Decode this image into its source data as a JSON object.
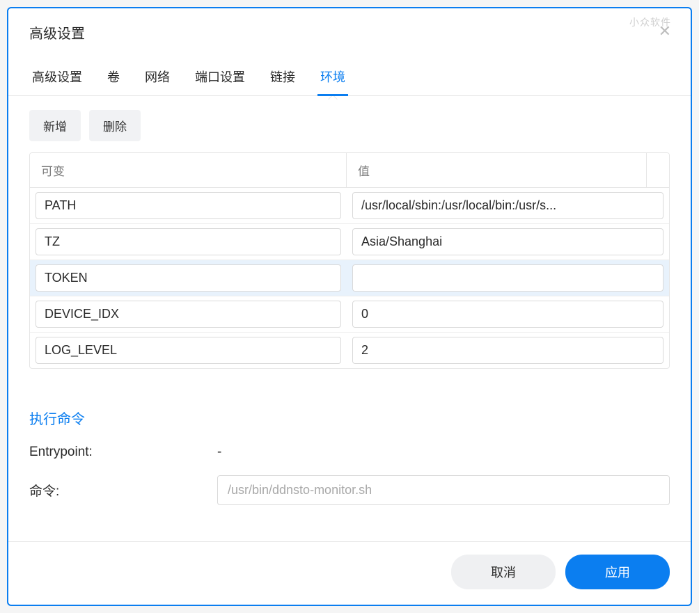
{
  "modal": {
    "title": "高级设置",
    "watermark": "小众软件"
  },
  "tabs": [
    {
      "label": "高级设置",
      "active": false
    },
    {
      "label": "卷",
      "active": false
    },
    {
      "label": "网络",
      "active": false
    },
    {
      "label": "端口设置",
      "active": false
    },
    {
      "label": "链接",
      "active": false
    },
    {
      "label": "环境",
      "active": true
    }
  ],
  "toolbar": {
    "add": "新增",
    "delete": "删除"
  },
  "table": {
    "header_key": "可变",
    "header_value": "值",
    "rows": [
      {
        "key": "PATH",
        "value": "/usr/local/sbin:/usr/local/bin:/usr/s...",
        "selected": false
      },
      {
        "key": "TZ",
        "value": "Asia/Shanghai",
        "selected": false
      },
      {
        "key": "TOKEN",
        "value": "",
        "selected": true
      },
      {
        "key": "DEVICE_IDX",
        "value": "0",
        "selected": false
      },
      {
        "key": "LOG_LEVEL",
        "value": "2",
        "selected": false
      }
    ]
  },
  "exec": {
    "section_title": "执行命令",
    "entrypoint_label": "Entrypoint:",
    "entrypoint_value": "-",
    "command_label": "命令:",
    "command_value": "/usr/bin/ddnsto-monitor.sh"
  },
  "footer": {
    "cancel": "取消",
    "apply": "应用"
  }
}
